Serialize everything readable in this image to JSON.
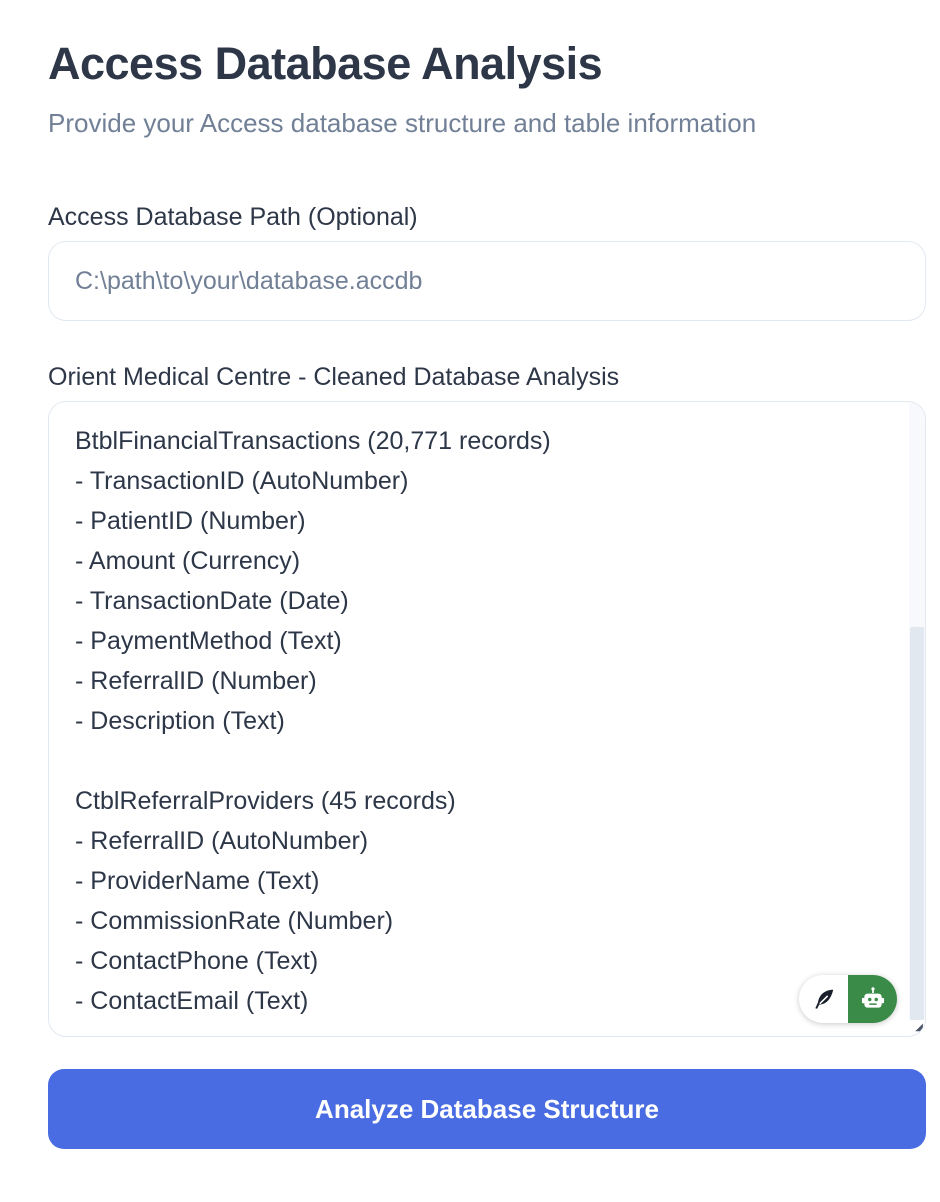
{
  "header": {
    "title": "Access Database Analysis",
    "subtitle": "Provide your Access database structure and table information"
  },
  "path_field": {
    "label": "Access Database Path (Optional)",
    "value": "",
    "placeholder": "C:\\path\\to\\your\\database.accdb"
  },
  "structure_field": {
    "label": "Orient Medical Centre - Cleaned Database Analysis",
    "value": "BtblFinancialTransactions (20,771 records)\n- TransactionID (AutoNumber)\n- PatientID (Number)\n- Amount (Currency)\n- TransactionDate (Date)\n- PaymentMethod (Text)\n- ReferralID (Number)\n- Description (Text)\n\nCtblReferralProviders (45 records)\n- ReferralID (AutoNumber)\n- ProviderName (Text)\n- CommissionRate (Number)\n- ContactPhone (Text)\n- ContactEmail (Text)"
  },
  "widget": {
    "left_icon": "feather-icon",
    "right_icon": "robot-icon",
    "right_bg": "#3a8a48"
  },
  "submit": {
    "label": "Analyze Database Structure",
    "color": "#4a6ce2"
  },
  "colors": {
    "heading": "#2d3748",
    "muted": "#718096",
    "border": "#e2e8f0"
  }
}
